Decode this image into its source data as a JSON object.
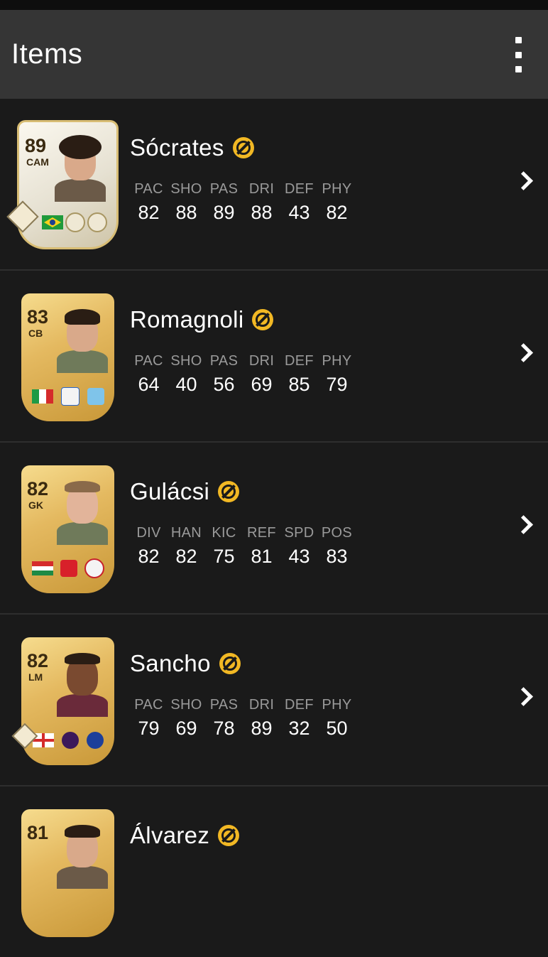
{
  "app_bar": {
    "title": "Items",
    "menu_icon": "more-vert-icon"
  },
  "colors": {
    "background": "#1a1a1a",
    "app_bar": "#353535",
    "untradeable_badge": "#f2b824",
    "stat_label": "#9a9a9a"
  },
  "items": [
    {
      "name": "Sócrates",
      "rating": "89",
      "position": "CAM",
      "card_style": "icon",
      "stats": [
        {
          "label": "PAC",
          "value": "82"
        },
        {
          "label": "SHO",
          "value": "88"
        },
        {
          "label": "PAS",
          "value": "89"
        },
        {
          "label": "DRI",
          "value": "88"
        },
        {
          "label": "DEF",
          "value": "43"
        },
        {
          "label": "PHY",
          "value": "82"
        }
      ]
    },
    {
      "name": "Romagnoli",
      "rating": "83",
      "position": "CB",
      "card_style": "gold",
      "stats": [
        {
          "label": "PAC",
          "value": "64"
        },
        {
          "label": "SHO",
          "value": "40"
        },
        {
          "label": "PAS",
          "value": "56"
        },
        {
          "label": "DRI",
          "value": "69"
        },
        {
          "label": "DEF",
          "value": "85"
        },
        {
          "label": "PHY",
          "value": "79"
        }
      ]
    },
    {
      "name": "Gulácsi",
      "rating": "82",
      "position": "GK",
      "card_style": "gold",
      "stats": [
        {
          "label": "DIV",
          "value": "82"
        },
        {
          "label": "HAN",
          "value": "82"
        },
        {
          "label": "KIC",
          "value": "75"
        },
        {
          "label": "REF",
          "value": "81"
        },
        {
          "label": "SPD",
          "value": "43"
        },
        {
          "label": "POS",
          "value": "83"
        }
      ]
    },
    {
      "name": "Sancho",
      "rating": "82",
      "position": "LM",
      "card_style": "gold",
      "stats": [
        {
          "label": "PAC",
          "value": "79"
        },
        {
          "label": "SHO",
          "value": "69"
        },
        {
          "label": "PAS",
          "value": "78"
        },
        {
          "label": "DRI",
          "value": "89"
        },
        {
          "label": "DEF",
          "value": "32"
        },
        {
          "label": "PHY",
          "value": "50"
        }
      ]
    },
    {
      "name": "Álvarez",
      "rating": "81",
      "position": "",
      "card_style": "gold",
      "stats": []
    }
  ]
}
